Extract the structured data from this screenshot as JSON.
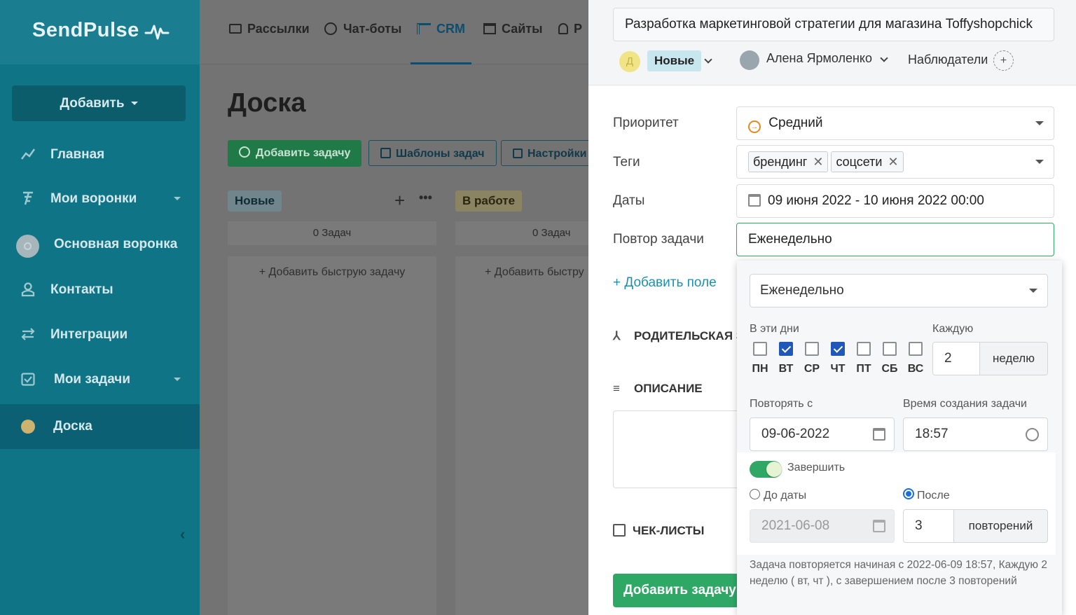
{
  "sidebar": {
    "logo": "SendPulse",
    "add_button": "Добавить",
    "items": [
      {
        "label": "Главная",
        "icon": "chart-line-icon"
      },
      {
        "label": "Мои воронки",
        "icon": "funnel-icon"
      },
      {
        "label": "Основная воронка",
        "icon": "pipeline-circle-icon"
      },
      {
        "label": "Контакты",
        "icon": "contacts-icon"
      },
      {
        "label": "Интеграции",
        "icon": "integrations-icon"
      },
      {
        "label": "Мои задачи",
        "icon": "tasks-icon"
      },
      {
        "label": "Доска",
        "icon": "board-dot-icon"
      }
    ]
  },
  "topnav": {
    "items": [
      {
        "label": "Рассылки",
        "icon": "mail-icon"
      },
      {
        "label": "Чат-боты",
        "icon": "chatbot-icon"
      },
      {
        "label": "CRM",
        "icon": "crm-icon"
      },
      {
        "label": "Сайты",
        "icon": "sites-icon"
      },
      {
        "label": "Р",
        "icon": "bell-icon"
      }
    ]
  },
  "board": {
    "title": "Доска",
    "add_task": "Добавить задачу",
    "templates": "Шаблоны задач",
    "settings": "Настройки",
    "columns": [
      {
        "name": "Новые",
        "count": "0 Задач",
        "quick_add": "Добавить быструю задачу"
      },
      {
        "name": "В работе",
        "count": "0 Задач",
        "quick_add": "Добавить быстру"
      }
    ]
  },
  "panel": {
    "task_title": "Разработка маркетинговой стратегии для магазина Toffyshopchick",
    "avatar_letter": "Д",
    "status": "Новые",
    "assignee": "Алена Ярмоленко",
    "watchers": "Наблюдатели",
    "fields": {
      "priority_label": "Приоритет",
      "priority_value": "Средний",
      "tags_label": "Теги",
      "tags": [
        "брендинг",
        "соцсети"
      ],
      "dates_label": "Даты",
      "dates_value": "09 июня 2022 - 10 июня 2022 00:00",
      "repeat_label": "Повтор задачи",
      "repeat_value": "Еженедельно"
    },
    "add_field": "+ Добавить поле",
    "parent_section": "РОДИТЕЛЬСКАЯ З",
    "description_section": "ОПИСАНИЕ",
    "checklists_section": "ЧЕК-ЛИСТЫ",
    "submit": "Добавить задачу"
  },
  "repeat_popup": {
    "frequency": "Еженедельно",
    "days_label": "В эти дни",
    "days": [
      {
        "label": "ПН",
        "checked": false
      },
      {
        "label": "ВТ",
        "checked": true
      },
      {
        "label": "СР",
        "checked": false
      },
      {
        "label": "ЧТ",
        "checked": true
      },
      {
        "label": "ПТ",
        "checked": false
      },
      {
        "label": "СБ",
        "checked": false
      },
      {
        "label": "ВС",
        "checked": false
      }
    ],
    "every_label": "Каждую",
    "every_value": "2",
    "every_unit": "неделю",
    "start_label": "Повторять с",
    "start_date": "09-06-2022",
    "time_label": "Время создания задачи",
    "time_value": "18:57",
    "finish_label": "Завершить",
    "finish_enabled": true,
    "until_date_label": "До даты",
    "until_date_value": "2021-06-08",
    "after_label": "После",
    "after_selected": true,
    "after_value": "3",
    "after_unit": "повторений",
    "summary": "Задача повторяется начиная с 2022-06-09 18:57, Каждую 2 неделю ( вт, чт ), с завершением после 3 повторений"
  },
  "colors": {
    "sidebar": "#0f7486",
    "accent_green": "#2fa866",
    "check_blue": "#1f58b8",
    "overlay": "#737373"
  }
}
